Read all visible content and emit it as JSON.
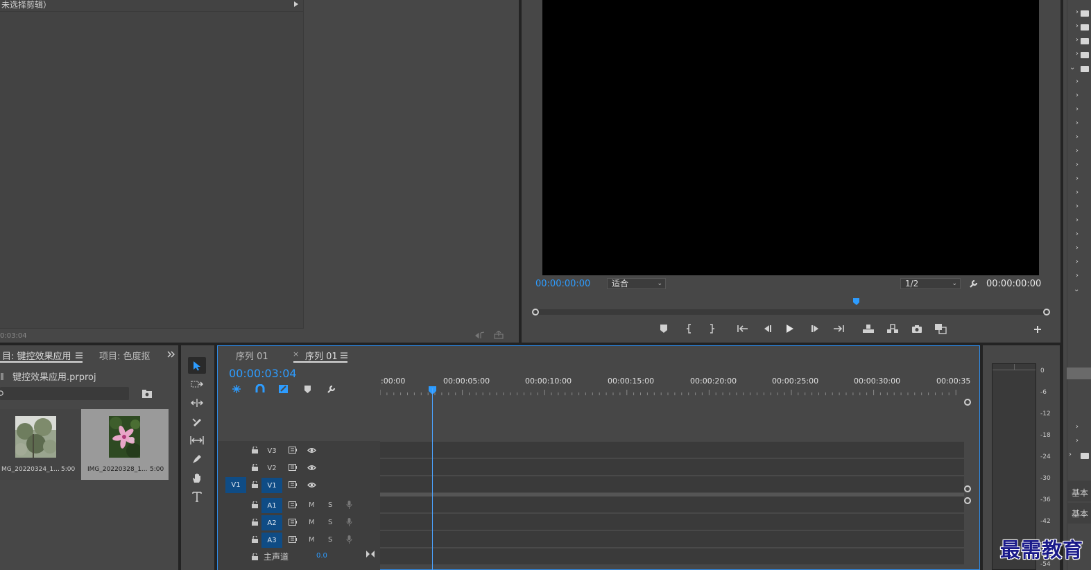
{
  "effect_controls": {
    "no_clip_label": "未选择剪辑）",
    "timecode": "0:03:04"
  },
  "program_monitor": {
    "timecode_left": "00:00:00:00",
    "fit_label": "适合",
    "resolution_label": "1/2",
    "timecode_right": "00:00:00:00"
  },
  "project": {
    "tab_active": "目: 键控效果应用",
    "tab_other": "项目: 色度抠",
    "file_name": "键控效果应用.prproj",
    "items": [
      {
        "name": "MG_20220324_1...",
        "duration": "5:00"
      },
      {
        "name": "IMG_20220328_1...",
        "duration": "5:00"
      }
    ]
  },
  "timeline": {
    "tab_inactive": "序列 01",
    "tab_active": "序列 01",
    "timecode": "00:00:03:04",
    "ruler_labels": [
      ":00:00",
      "00:00:05:00",
      "00:00:10:00",
      "00:00:15:00",
      "00:00:20:00",
      "00:00:25:00",
      "00:00:30:00",
      "00:00:35"
    ],
    "video_tracks": [
      "V3",
      "V2",
      "V1"
    ],
    "source_patch": "V1",
    "audio_tracks": [
      "A1",
      "A2",
      "A3"
    ],
    "mute_label": "M",
    "solo_label": "S",
    "master_label": "主声道",
    "master_value": "0.0"
  },
  "audio_meter": {
    "db_labels": [
      "0",
      "-6",
      "-12",
      "-18",
      "-24",
      "-30",
      "-36",
      "-42",
      "-48",
      "-54"
    ]
  },
  "right_panel": {
    "labels": [
      "基本",
      "基本"
    ]
  },
  "watermark": "最需教育",
  "colors": {
    "accent_blue": "#2d9cff",
    "track_blue": "#0f4c85",
    "panel_bg": "#474747"
  }
}
